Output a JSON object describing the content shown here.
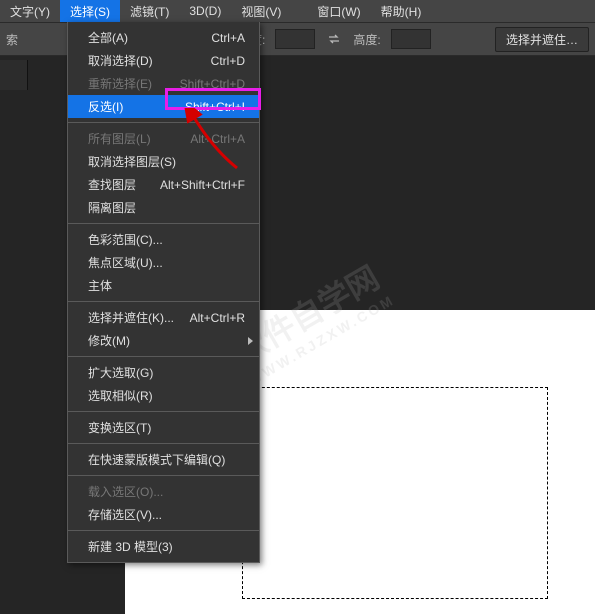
{
  "menubar": {
    "items": [
      {
        "label": "文字(Y)"
      },
      {
        "label": "选择(S)"
      },
      {
        "label": "滤镜(T)"
      },
      {
        "label": "3D(D)"
      },
      {
        "label": "视图(V)"
      },
      {
        "label": "窗口(W)"
      },
      {
        "label": "帮助(H)"
      }
    ]
  },
  "toolbar": {
    "search_label": "索",
    "width_label": "宽度:",
    "height_label": "高度:",
    "select_mask_btn": "选择并遮住…"
  },
  "dropdown": {
    "sections": [
      [
        {
          "label": "全部(A)",
          "shortcut": "Ctrl+A",
          "state": "normal"
        },
        {
          "label": "取消选择(D)",
          "shortcut": "Ctrl+D",
          "state": "normal"
        },
        {
          "label": "重新选择(E)",
          "shortcut": "Shift+Ctrl+D",
          "state": "disabled"
        },
        {
          "label": "反选(I)",
          "shortcut": "Shift+Ctrl+I",
          "state": "active"
        }
      ],
      [
        {
          "label": "所有图层(L)",
          "shortcut": "Alt+Ctrl+A",
          "state": "disabled"
        },
        {
          "label": "取消选择图层(S)",
          "shortcut": "",
          "state": "normal"
        },
        {
          "label": "查找图层",
          "shortcut": "Alt+Shift+Ctrl+F",
          "state": "normal"
        },
        {
          "label": "隔离图层",
          "shortcut": "",
          "state": "normal"
        }
      ],
      [
        {
          "label": "色彩范围(C)...",
          "shortcut": "",
          "state": "normal"
        },
        {
          "label": "焦点区域(U)...",
          "shortcut": "",
          "state": "normal"
        },
        {
          "label": "主体",
          "shortcut": "",
          "state": "normal"
        }
      ],
      [
        {
          "label": "选择并遮住(K)...",
          "shortcut": "Alt+Ctrl+R",
          "state": "normal"
        },
        {
          "label": "修改(M)",
          "shortcut": "",
          "state": "normal",
          "submenu": true
        }
      ],
      [
        {
          "label": "扩大选取(G)",
          "shortcut": "",
          "state": "normal"
        },
        {
          "label": "选取相似(R)",
          "shortcut": "",
          "state": "normal"
        }
      ],
      [
        {
          "label": "变换选区(T)",
          "shortcut": "",
          "state": "normal"
        }
      ],
      [
        {
          "label": "在快速蒙版模式下编辑(Q)",
          "shortcut": "",
          "state": "normal"
        }
      ],
      [
        {
          "label": "载入选区(O)...",
          "shortcut": "",
          "state": "disabled"
        },
        {
          "label": "存储选区(V)...",
          "shortcut": "",
          "state": "normal"
        }
      ],
      [
        {
          "label": "新建 3D 模型(3)",
          "shortcut": "",
          "state": "normal"
        }
      ]
    ]
  },
  "watermark": {
    "main": "软件自学网",
    "sub": "WWW.RJZXW.COM"
  }
}
